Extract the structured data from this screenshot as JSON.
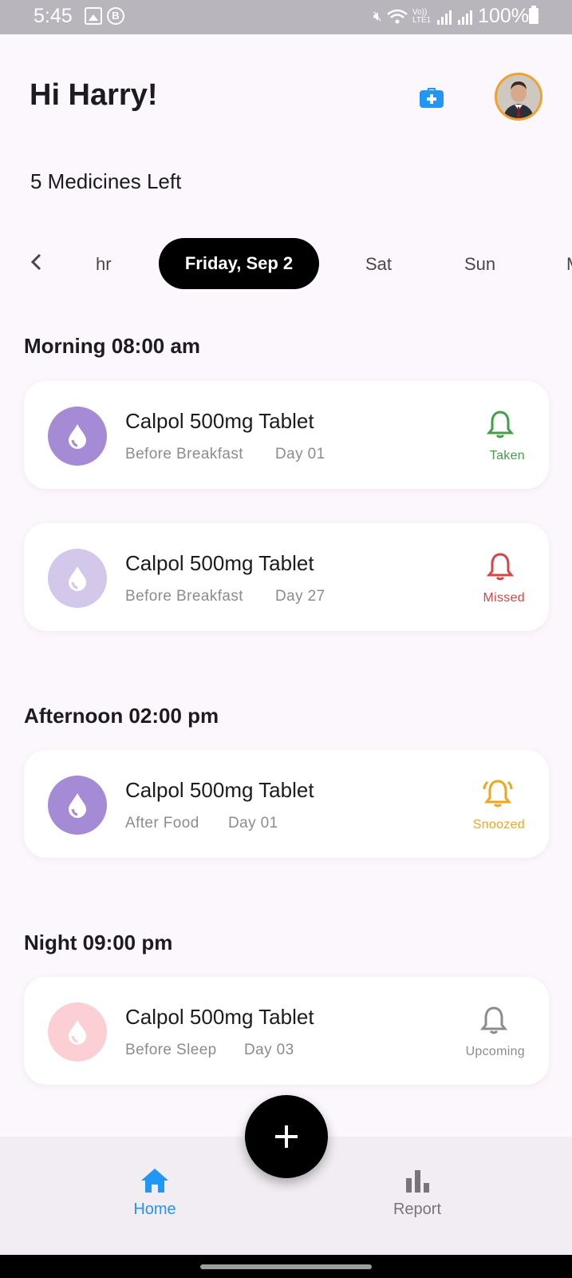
{
  "status_bar": {
    "time": "5:45",
    "battery": "100%",
    "b_icon": "B",
    "network": "Vo)) LTE1"
  },
  "header": {
    "greeting": "Hi Harry!",
    "subtitle": "5 Medicines Left"
  },
  "date_strip": {
    "prev_partial": "hr",
    "selected": "Friday, Sep 2",
    "next1": "Sat",
    "next2": "Sun",
    "next_partial": "M"
  },
  "sections": [
    {
      "title": "Morning 08:00 am",
      "items": [
        {
          "name": "Calpol 500mg Tablet",
          "timing": "Before Breakfast",
          "day": "Day 01",
          "status": "Taken",
          "status_color": "#43a047",
          "pill_color": "#a58bd6"
        },
        {
          "name": "Calpol 500mg Tablet",
          "timing": "Before Breakfast",
          "day": "Day 27",
          "status": "Missed",
          "status_color": "#d64545",
          "pill_color": "#d3c7ea"
        }
      ]
    },
    {
      "title": "Afternoon 02:00 pm",
      "items": [
        {
          "name": "Calpol 500mg Tablet",
          "timing": "After Food",
          "day": "Day 01",
          "status": "Snoozed",
          "status_color": "#f2a51a",
          "pill_color": "#a58bd6"
        }
      ]
    },
    {
      "title": "Night 09:00 pm",
      "items": [
        {
          "name": "Calpol 500mg Tablet",
          "timing": "Before Sleep",
          "day": "Day 03",
          "status": "Upcoming",
          "status_color": "#8e8a93",
          "pill_color": "#fccfd4"
        }
      ]
    }
  ],
  "bottom_nav": {
    "home": "Home",
    "report": "Report",
    "active_color": "#2196f3",
    "inactive_color": "#77747c"
  },
  "icons": {
    "kit": "first-aid-kit-icon",
    "pill": "water-drop-icon",
    "status": "bell-icon",
    "fab": "plus-icon"
  }
}
